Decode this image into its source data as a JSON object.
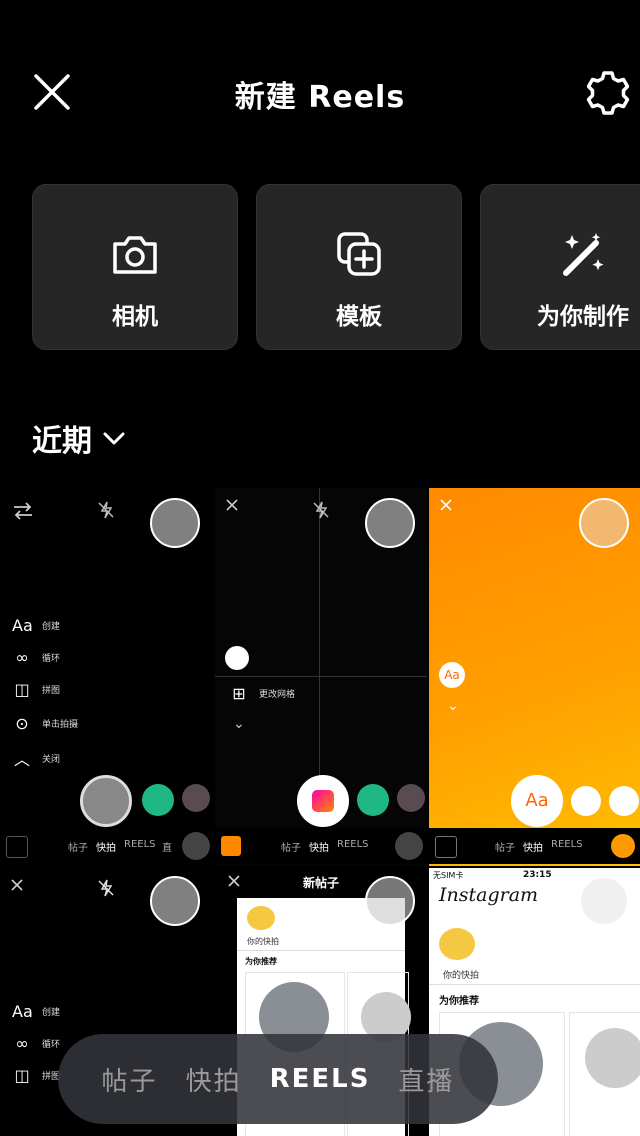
{
  "header": {
    "title": "新建 Reels"
  },
  "cards": [
    {
      "label": "相机",
      "icon": "camera-icon"
    },
    {
      "label": "模板",
      "icon": "template-add-icon"
    },
    {
      "label": "为你制作",
      "icon": "magic-wand-icon"
    }
  ],
  "recent": {
    "label": "近期"
  },
  "thumbs": {
    "t1": {
      "menu": [
        "创建",
        "循环",
        "拼图",
        "单击拍摄",
        "关闭"
      ],
      "tabs": [
        "帖子",
        "快拍",
        "REELS",
        "直"
      ]
    },
    "t2": {
      "menu_item": "更改网格",
      "tabs": [
        "帖子",
        "快拍",
        "REELS"
      ]
    },
    "t3": {
      "tabs": [
        "帖子",
        "快拍",
        "REELS"
      ]
    },
    "t4": {
      "menu": [
        "创建",
        "循环",
        "拼图"
      ]
    },
    "t5": {
      "title": "新帖子",
      "your_story": "你的快拍",
      "recommended": "为你推荐"
    },
    "t6": {
      "status_carrier": "无SIM卡",
      "status_time": "23:15",
      "app_name": "Instagram",
      "your_story": "你的快拍",
      "recommended": "为你推荐"
    }
  },
  "modes": [
    {
      "label": "帖子",
      "active": false
    },
    {
      "label": "快拍",
      "active": false
    },
    {
      "label": "REELS",
      "active": true
    },
    {
      "label": "直播",
      "active": false
    }
  ]
}
